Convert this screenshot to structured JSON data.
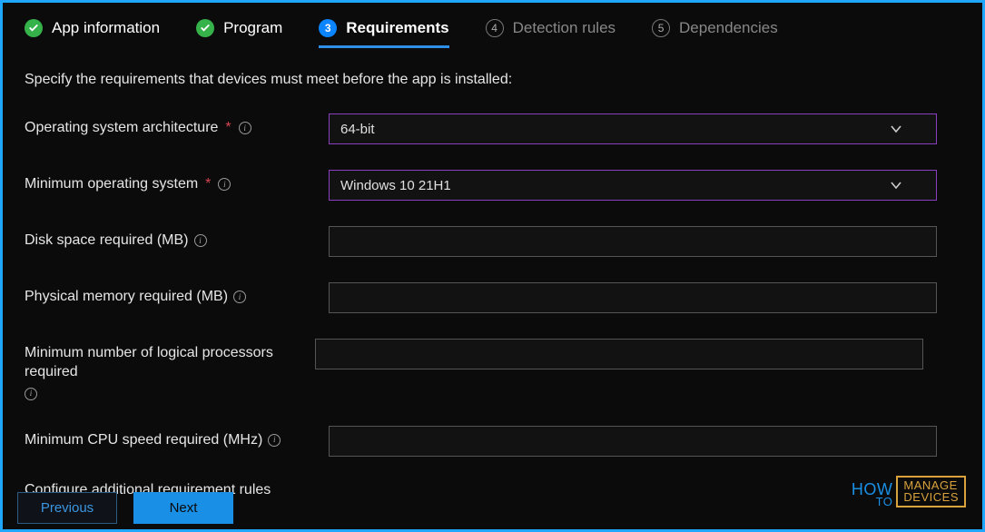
{
  "steps": {
    "s1": {
      "num": "",
      "label": "App information"
    },
    "s2": {
      "num": "",
      "label": "Program"
    },
    "s3": {
      "num": "3",
      "label": "Requirements"
    },
    "s4": {
      "num": "4",
      "label": "Detection rules"
    },
    "s5": {
      "num": "5",
      "label": "Dependencies"
    }
  },
  "instruction": "Specify the requirements that devices must meet before the app is installed:",
  "fields": {
    "osArch": {
      "label": "Operating system architecture",
      "value": "64-bit"
    },
    "minOS": {
      "label": "Minimum operating system",
      "value": "Windows 10 21H1"
    },
    "disk": {
      "label": "Disk space required (MB)",
      "value": ""
    },
    "memory": {
      "label": "Physical memory required (MB)",
      "value": ""
    },
    "cores": {
      "label": "Minimum number of logical processors required",
      "value": ""
    },
    "cpu": {
      "label": "Minimum CPU speed required (MHz)",
      "value": ""
    }
  },
  "additionalRules": "Configure additional requirement rules",
  "buttons": {
    "previous": "Previous",
    "next": "Next"
  },
  "info_glyph": "i",
  "watermark": {
    "l1": "HOW",
    "l2": "TO",
    "r1": "MANAGE",
    "r2": "DEVICES"
  }
}
